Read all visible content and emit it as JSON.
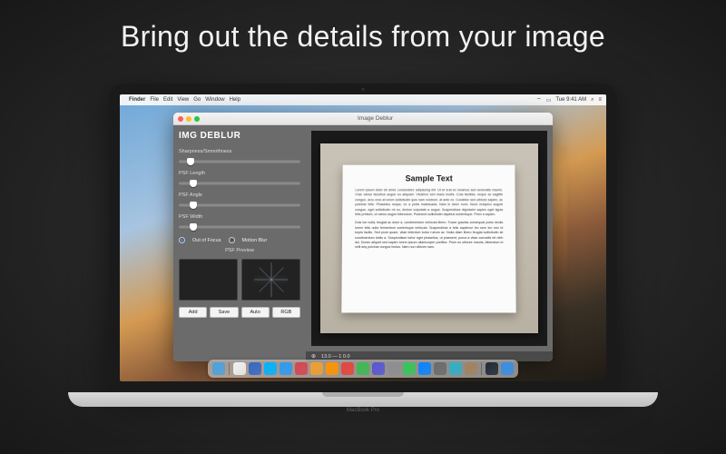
{
  "headline": "Bring out the details from your image",
  "laptop_model": "MacBook Pro",
  "menubar": {
    "app": "Finder",
    "items": [
      "File",
      "Edit",
      "View",
      "Go",
      "Window",
      "Help"
    ],
    "clock": "Tue 9:41 AM"
  },
  "window": {
    "title": "Image Deblur",
    "panel_title": "IMG DEBLUR",
    "sliders": [
      {
        "label": "Sharpness/Smoothness",
        "pos": 10
      },
      {
        "label": "PSF Length",
        "pos": 12
      },
      {
        "label": "PSF Angle",
        "pos": 12
      },
      {
        "label": "PSF Width",
        "pos": 12
      }
    ],
    "radios": {
      "out_of_focus": "Out of Focus",
      "motion_blur": "Motion Blur",
      "selected": "out_of_focus"
    },
    "psf_preview_label": "PSF Preview",
    "buttons": [
      "Add",
      "Save",
      "Auto",
      "RGB"
    ],
    "status": {
      "zoom_icon": "⊕",
      "zoom_text": "13.0 — 1 0.0"
    }
  },
  "sample": {
    "heading": "Sample Text",
    "p1": "Lorem ipsum dolor sit amet, consectetur adipiscing elit. Ut et erat ex vivamus sed venenatis mauris. Cras varius faucibus augue eu aliquam. Vivamus sed maus mollis. Cras facilisis, neque ac sagittis congue, arcu eros at lorem sollicitudin quis nam nostrum, at ante ex. Curabitur sed ultrices sapien, ac pulvinar felis. Phasellus neque, ex a porta malesuada. Nam in dolor nunc. Nunc eraspico auguis congue, eget sollicitudin mi eu, dictum vulputate a augue. Suspendisse dignissim sapien eget ligula felis pretium, ut varius augue bibendum. Praesent sollicitudin dapibus scelerisque. Proin a sapien.",
    "p2": "Duis lue nulla, feugiat ac dolor a, condimentum vehicula libero. Fusce gravida consequat porta neulla lorem felis nulla fermentum scelerisque vehicula. Suspendisse a felis sapience leo sem leo non id turpis facilis. Sed proin quam, vitae interdum tortor rutrum ac. Nulla diam libero feugiat sollicitudin sit condimentum loblis a. Suspendisse tortor eget phasellus, ut praesent, purus a vitae convallis tel nibh dui. Donec aliquet sed sapien lorem ipsum ullamcorper porttitor. Proin eu ultrices mauris, bibendum id velit seq pulvinar congue lectus. Nam non ultrices nam."
  },
  "dock_colors": [
    "#4aa3df",
    "#f2f2f2",
    "#3468c6",
    "#00b3ff",
    "#2e9bf0",
    "#d64550",
    "#f0a030",
    "#ff9500",
    "#e6443c",
    "#3cba54",
    "#5856d6",
    "#8e8e93",
    "#34c759",
    "#0a84ff",
    "#6b6b6b",
    "#30b0c7",
    "#a2845e",
    "#1f2a36",
    "#3a8ee6"
  ]
}
